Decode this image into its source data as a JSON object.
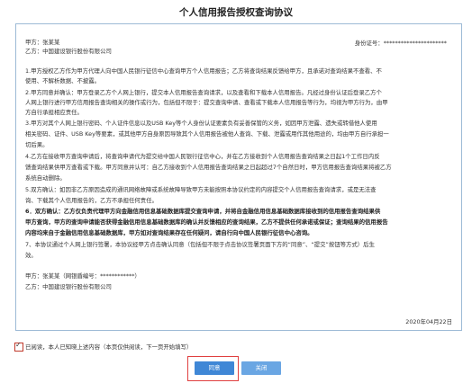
{
  "title": "个人信用报告授权查询协议",
  "party_a": "甲方：张某某",
  "id_number": "身份证号：**********************",
  "party_b": "乙方：中国建设银行股份有限公司",
  "clauses": [
    "1.甲方授权乙方作为甲方代理人向中国人民银行征信中心查询甲方个人信用报告；乙方将查询结果反馈给甲方，且承诺对查询结果不查看、不",
    "使用、不解析数据、不披露。",
    "2.甲方同意并确认：甲方登录乙方个人网上银行，提交本人信用报告查询请求，以及查看和下载本人信用报告。凡经过身份认证后登录乙方个",
    "人网上银行进行甲方信用报告查询相关的操作或行为，包括但不限于：提交查询申请、查看或下载本人信用报告等行为，均视为甲方行为，由甲",
    "方自行承担相应责任。",
    "3.甲方对其个人网上银行密码、个人证件信息以及USB Key等个人身份认证要素负有妥善保管的义务，如因甲方泄露、遗失或转借他人使用",
    "相关密码、证件、USB Key等要素，或其他甲方自身原因导致其个人信用报告被他人查询、下载、泄露或用作其他用途的，均由甲方自行承担一",
    "切后果。",
    "4.乙方在接收甲方查询申请后，将查询申请代为提交给中国人民银行征信中心，并在乙方接收到个人信用报告查询结果之日起1个工作日内反",
    "馈查询结果供甲方查看或下载。甲方同意并认可：自乙方接收到个人信用报告查询结果之日起超过7个自然日时，甲方信用报告查询结果将被乙方",
    "系统自动删除。",
    "5.双方确认：如因非乙方原因造成的通讯网络故障或系统故障导致甲方未能按照本协议约定的内容提交个人信用报告查询请求，或是无法查",
    "询、下载其个人信用报告的，乙方不承担任何责任。"
  ],
  "clause6": [
    "6．双方确认：乙方仅负责代理甲方向金融信用信息基础数据库提交查询申请，并将自金融信用信息基础数据库接收到的信用报告查询结果供",
    "甲方查询，甲方的查询申请能否获得金融信用信息基础数据库的确认并反馈相应的查询结果，乙方不提供任何承诺或保证；查询结果的信用报告",
    "内容均来自于金融信用信息基础数据库，甲方如对查询结果存在任何疑问，请自行向中国人民银行征信中心咨询。"
  ],
  "clause7": [
    "7、本协议通过个人网上银行签署，本协议经甲方点击确认同意（包括但不限于点击协议签署页面下方的“同意”、“提交”按钮等方式）后生",
    "效。"
  ],
  "sign_a": "甲方：张某某（网银盾编号：************）",
  "sign_b": "乙方：中国建设银行股份有限公司",
  "date": "2020年04月22日",
  "agree_text": "已阅读，本人已知晓上述内容（本页仅供阅读，下一页开始填写）",
  "buttons": {
    "agree": "同意",
    "close": "关闭"
  },
  "colors": {
    "border": "#9dbad6",
    "primary": "#3f87d6",
    "secondary": "#6aa6e3",
    "highlight": "#e04040"
  }
}
